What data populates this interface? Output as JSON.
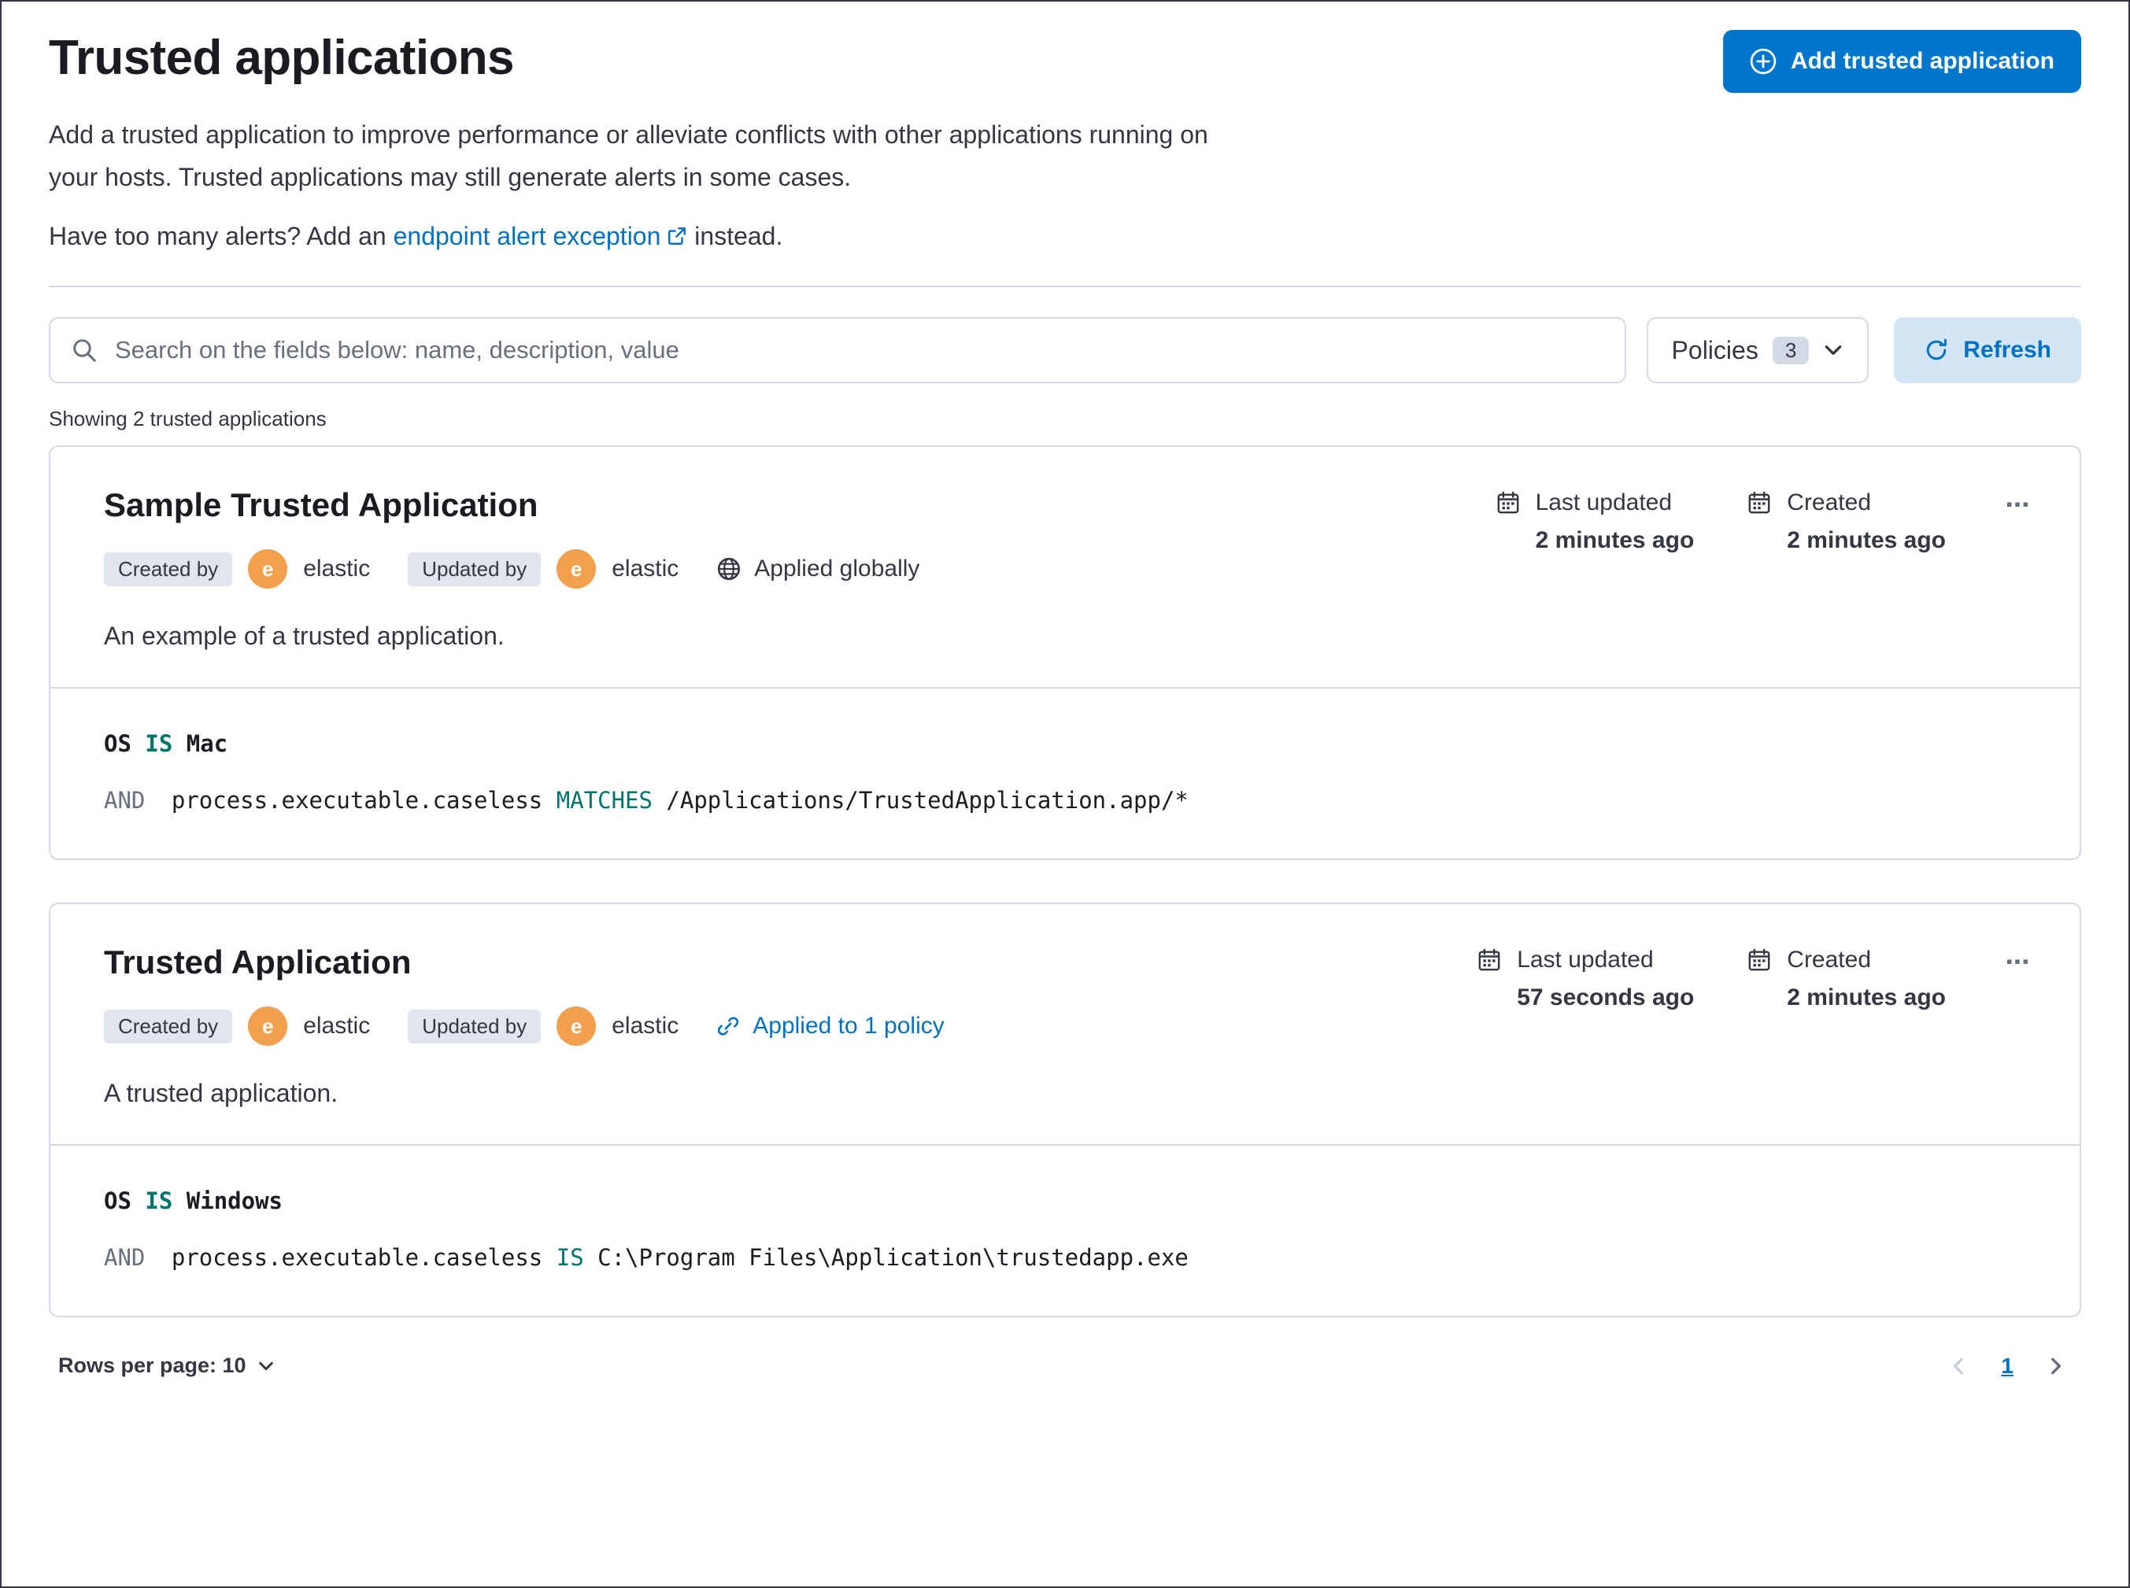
{
  "header": {
    "title": "Trusted applications",
    "add_button_label": "Add trusted application",
    "description_line1": "Add a trusted application to improve performance or alleviate conflicts with other applications running on",
    "description_line2": "your hosts. Trusted applications may still generate alerts in some cases.",
    "alerts_prefix": "Have too many alerts? Add an",
    "alerts_link_label": "endpoint alert exception",
    "alerts_suffix": "instead."
  },
  "controls": {
    "search_placeholder": "Search on the fields below: name, description, value",
    "policies_label": "Policies",
    "policies_count": "3",
    "refresh_label": "Refresh",
    "results_text": "Showing 2 trusted applications"
  },
  "cards": [
    {
      "title": "Sample Trusted Application",
      "created_by_label": "Created by",
      "created_by_avatar": "e",
      "created_by_name": "elastic",
      "updated_by_label": "Updated by",
      "updated_by_avatar": "e",
      "updated_by_name": "elastic",
      "scope_label": "Applied globally",
      "last_updated_label": "Last updated",
      "last_updated_value": "2 minutes ago",
      "created_label": "Created",
      "created_value": "2 minutes ago",
      "description": "An example of a trusted application.",
      "condition1": {
        "field": "OS",
        "operator": "IS",
        "value": "Mac"
      },
      "condition2": {
        "conjunction": "AND",
        "field": "process.executable.caseless",
        "operator": "MATCHES",
        "value": "/Applications/TrustedApplication.app/*"
      }
    },
    {
      "title": "Trusted Application",
      "created_by_label": "Created by",
      "created_by_avatar": "e",
      "created_by_name": "elastic",
      "updated_by_label": "Updated by",
      "updated_by_avatar": "e",
      "updated_by_name": "elastic",
      "scope_label": "Applied to 1 policy",
      "last_updated_label": "Last updated",
      "last_updated_value": "57 seconds ago",
      "created_label": "Created",
      "created_value": "2 minutes ago",
      "description": "A trusted application.",
      "condition1": {
        "field": "OS",
        "operator": "IS",
        "value": "Windows"
      },
      "condition2": {
        "conjunction": "AND",
        "field": "process.executable.caseless",
        "operator": "IS",
        "value": "C:\\Program Files\\Application\\trustedapp.exe"
      }
    }
  ],
  "footer": {
    "rows_per_page_label": "Rows per page: 10",
    "current_page": "1"
  },
  "colors": {
    "primary_button": "#0077cc",
    "link_blue": "#0071c3",
    "operator_teal": "#00756b",
    "avatar_orange": "#f1a14d",
    "border_gray": "#d3dae6",
    "badge_gray": "#e0e5ee",
    "refresh_bg": "#d4e6f6",
    "text_dark": "#343741",
    "outer_border": "#343741"
  }
}
